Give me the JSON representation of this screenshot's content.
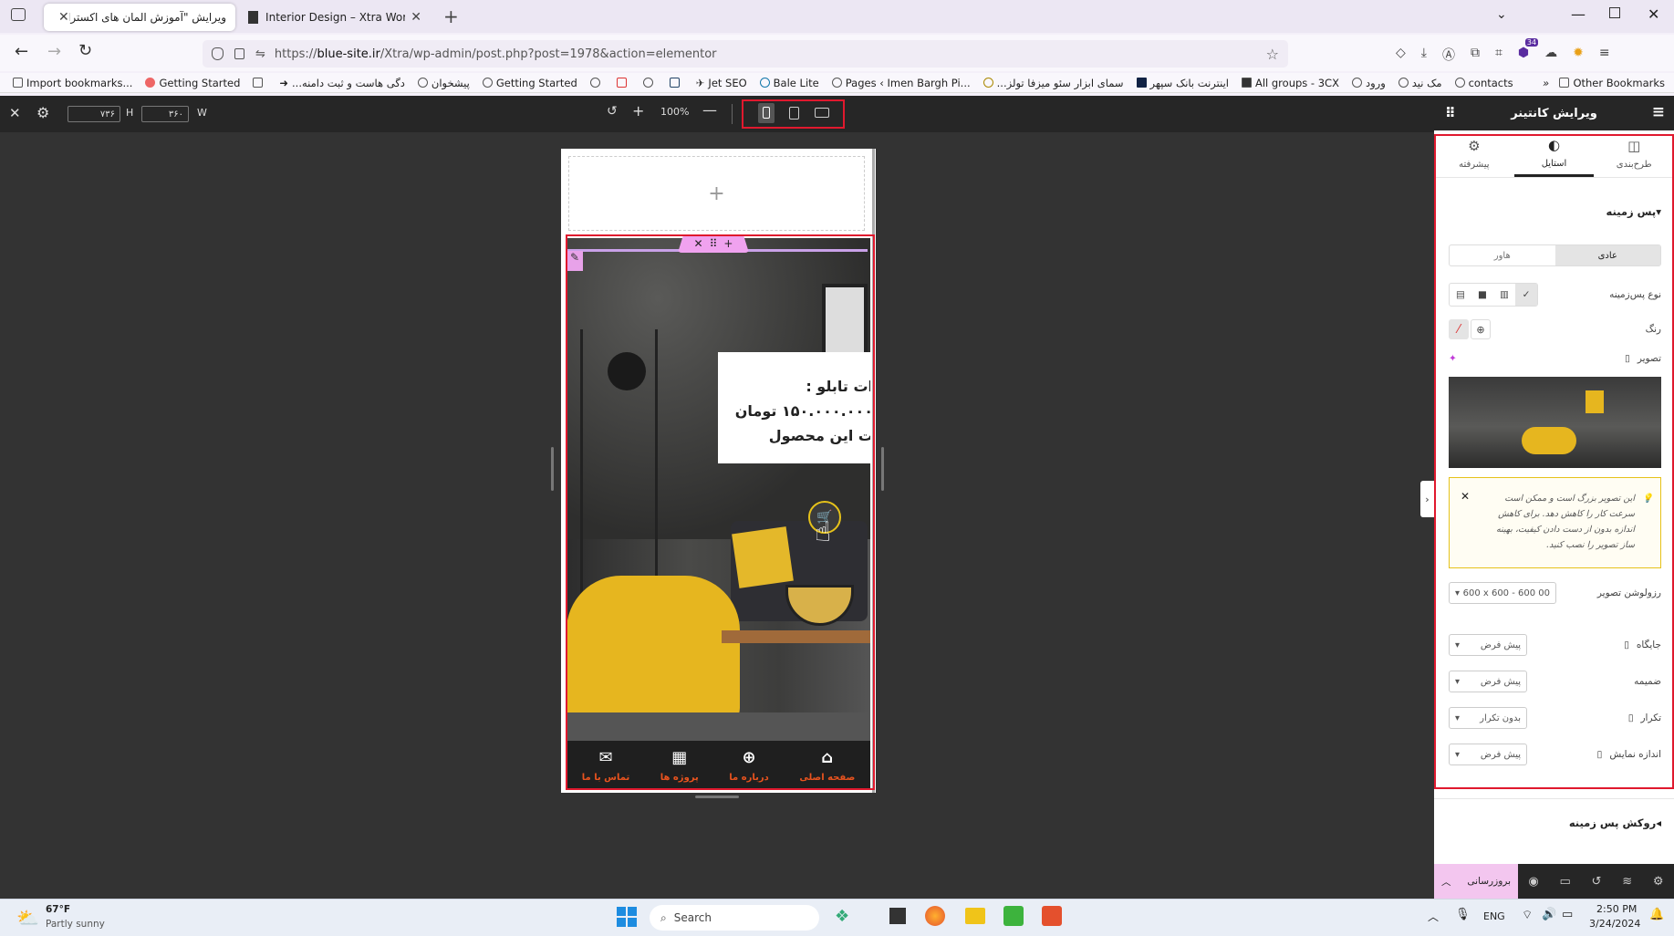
{
  "browser": {
    "tabs": [
      {
        "title": "ویرایش \"آموزش المان های اکسترا\""
      },
      {
        "title": "Interior Design – Xtra WordPress"
      }
    ],
    "url_prefix": "https://",
    "url_host": "blue-site.ir",
    "url_path": "/Xtra/wp-admin/post.php?post=1978&action=elementor",
    "bookmarks": [
      "Import bookmarks...",
      "Getting Started",
      "...دگی هاست و ثبت دامنه",
      "پیشخوان",
      "Getting Started",
      "Jet SEO",
      "Bale Lite",
      "Pages ‹ Imen Bargh Pi...",
      "...سمای ابزار سئو میزفا تولز",
      "اینترنت بانک سپهر",
      "All groups - 3CX",
      "ورود",
      "مک نید",
      "contacts"
    ],
    "other_bookmarks": "Other Bookmarks",
    "extension_badge": "34"
  },
  "toolbar": {
    "height_label": "H",
    "height_value": "۷۳۶",
    "width_label": "W",
    "width_value": "۳۶۰",
    "zoom": "100%"
  },
  "preview": {
    "price_lines": [
      "ات تابلو :",
      "۱۵۰.۰۰۰.۰۰۰ تومان",
      "ت این محصول"
    ],
    "nav": [
      {
        "label": "صفحه اصلی",
        "icon": "home-icon"
      },
      {
        "label": "درباره ما",
        "icon": "globe-icon"
      },
      {
        "label": "پروژه ها",
        "icon": "grid-icon"
      },
      {
        "label": "تماس با ما",
        "icon": "mail-icon"
      }
    ]
  },
  "panel": {
    "title": "ویرایش کانتینر",
    "tabs": [
      {
        "label": "طرح‌بندی"
      },
      {
        "label": "استایل"
      },
      {
        "label": "پیشرفته"
      }
    ],
    "section": "پس زمینه",
    "state_normal": "عادی",
    "state_hover": "هاور",
    "bg_type_label": "نوع پس‌زمینه",
    "color_label": "رنگ",
    "image_label": "تصویر",
    "notice": "این تصویر بزرگ است و ممکن است سرعت کار را کاهش دهد. برای کاهش اندازه بدون از دست دادن کیفیت، بهینه ساز تصویر را نصب کنید.",
    "resolution_label": "رزولوشن تصویر",
    "resolution_value": "600 x 600 - 600 00",
    "position_label": "جایگاه",
    "position_value": "پیش فرض",
    "attachment_label": "ضمیمه",
    "attachment_value": "پیش فرض",
    "repeat_label": "تکرار",
    "repeat_value": "بدون تکرار",
    "size_label": "اندازه نمایش",
    "size_value": "پیش فرض",
    "overlay_section": "روکش پس زمینه",
    "update_button": "بروزرسانی"
  },
  "taskbar": {
    "temp": "67°F",
    "weather": "Partly sunny",
    "search": "Search",
    "lang": "ENG",
    "time": "2:50 PM",
    "date": "3/24/2024"
  }
}
